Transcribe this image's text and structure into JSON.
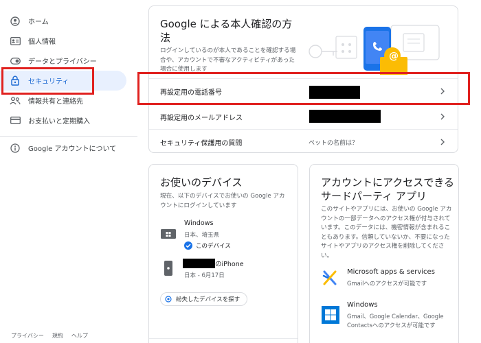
{
  "sidebar": {
    "items": [
      {
        "label": "ホーム",
        "icon": "home-icon"
      },
      {
        "label": "個人情報",
        "icon": "personal-info-icon"
      },
      {
        "label": "データとプライバシー",
        "icon": "toggle-icon"
      },
      {
        "label": "セキュリティ",
        "icon": "lock-icon"
      },
      {
        "label": "情報共有と連絡先",
        "icon": "people-icon"
      },
      {
        "label": "お支払いと定期購入",
        "icon": "credit-card-icon"
      }
    ],
    "about": {
      "label": "Google アカウントについて",
      "icon": "info-icon"
    },
    "footer": [
      "プライバシー",
      "規約",
      "ヘルプ"
    ]
  },
  "verify": {
    "title": "Google による本人確認の方法",
    "description": "ログインしているのが本人であることを確認する場合や、アカウントで不審なアクティビティがあった場合に使用します",
    "rows": [
      {
        "label": "再設定用の電話番号",
        "value": ""
      },
      {
        "label": "再設定用のメールアドレス",
        "value": ""
      },
      {
        "label": "セキュリティ保護用の質問",
        "value": "ペットの名前は？"
      }
    ]
  },
  "devices": {
    "title": "お使いのデバイス",
    "description": "現在、以下のデバイスでお使いの Google アカウントにログインしています",
    "list": [
      {
        "name": "Windows",
        "location": "日本、埼玉県",
        "badge": "このデバイス"
      },
      {
        "name": "のiPhone",
        "location": "日本 - 6月17日"
      }
    ],
    "find_button": "紛失したデバイスを探す"
  },
  "third_party": {
    "title": "アカウントにアクセスできるサードパーティ アプリ",
    "description": "このサイトやアプリには、お使いの Google アカウントの一部データへのアクセス権が付与されています。このデータには、機密情報が含まれることもあります。信頼していないか、不要になったサイトやアプリのアクセス権を削除してください。",
    "apps": [
      {
        "name": "Microsoft apps & services",
        "access": "Gmailへのアクセスが可能です"
      },
      {
        "name": "Windows",
        "access": "Gmail、Google Calendar、Google Contactsへのアクセスが可能です"
      }
    ]
  },
  "colors": {
    "accent": "#1a73e8",
    "active_bg": "#e8f0fe",
    "highlight": "#e0211f"
  }
}
